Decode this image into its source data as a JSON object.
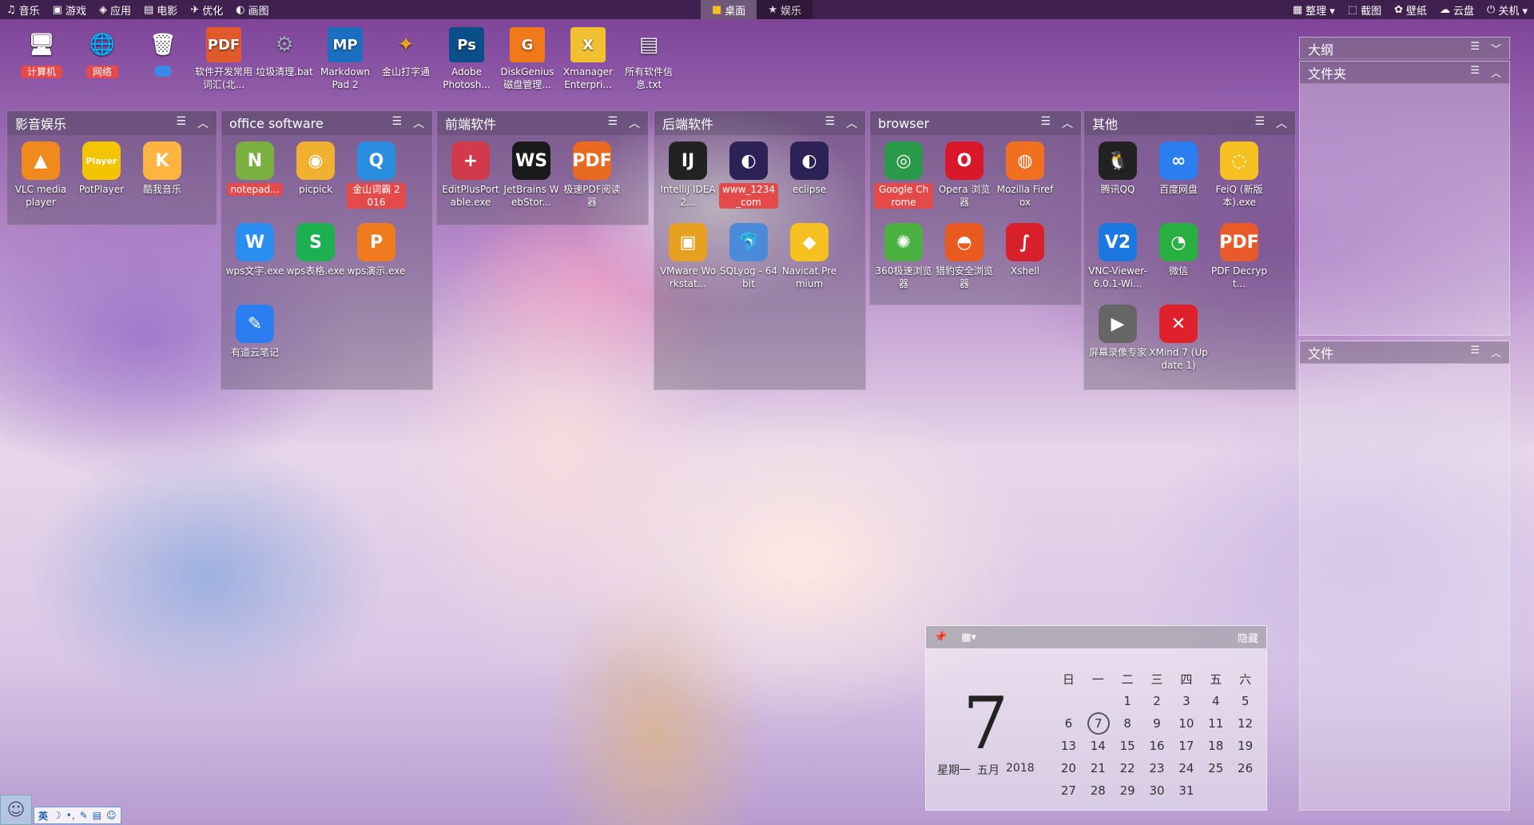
{
  "topbar": {
    "left": [
      {
        "icon": "music-note-icon",
        "glyph": "♫",
        "label": "音乐"
      },
      {
        "icon": "gamepad-icon",
        "glyph": "▣",
        "label": "游戏"
      },
      {
        "icon": "cube-icon",
        "glyph": "◈",
        "label": "应用"
      },
      {
        "icon": "film-icon",
        "glyph": "▤",
        "label": "电影"
      },
      {
        "icon": "rocket-icon",
        "glyph": "✈",
        "label": "优化"
      },
      {
        "icon": "palette-icon",
        "glyph": "◐",
        "label": "画图"
      }
    ],
    "tabs": [
      {
        "label": "桌面",
        "icon": "windows-logo-icon",
        "glyph": "■"
      },
      {
        "label": "娱乐",
        "icon": "star-icon",
        "glyph": "★"
      }
    ],
    "right": [
      {
        "icon": "organize-icon",
        "glyph": "▦",
        "label": "整理 ▾"
      },
      {
        "icon": "screenshot-icon",
        "glyph": "⬚",
        "label": "截图"
      },
      {
        "icon": "wallpaper-icon",
        "glyph": "✿",
        "label": "壁纸"
      },
      {
        "icon": "cloud-icon",
        "glyph": "☁",
        "label": "云盘"
      },
      {
        "icon": "power-icon",
        "glyph": "⏻",
        "label": "关机 ▾"
      }
    ]
  },
  "desktop_icons": [
    {
      "label": "计算机",
      "icon": "computer-icon",
      "glyph": "🖥",
      "tag": true
    },
    {
      "label": "网络",
      "icon": "network-globe-icon",
      "glyph": "🌐",
      "tag": true
    },
    {
      "label": "",
      "icon": "recycle-bin-icon",
      "glyph": "🗑",
      "tag_blue": true
    },
    {
      "label": "软件开发常用词汇(北...",
      "icon": "pdf-file-icon",
      "glyph": "PDF",
      "color": "#e05a2a"
    },
    {
      "label": "垃圾清理.bat",
      "icon": "bat-file-icon",
      "glyph": "⚙",
      "color": "#9aa8b8"
    },
    {
      "label": "Markdown Pad 2",
      "icon": "markdownpad-icon",
      "glyph": "MP",
      "color": "#1c6fc0"
    },
    {
      "label": "金山打字通",
      "icon": "jinshan-typing-icon",
      "glyph": "✦",
      "color": "#e8a020"
    },
    {
      "label": "Adobe Photosh...",
      "icon": "photoshop-icon",
      "glyph": "Ps",
      "color": "#0b4f8a"
    },
    {
      "label": "DiskGenius 磁盘管理...",
      "icon": "diskgenius-icon",
      "glyph": "G",
      "color": "#f07a1a"
    },
    {
      "label": "Xmanager Enterpri...",
      "icon": "xmanager-icon",
      "glyph": "X",
      "color": "#f0c030"
    },
    {
      "label": "所有软件信息.txt",
      "icon": "txt-file-icon",
      "glyph": "▤",
      "color": "#e8e8e8"
    }
  ],
  "fences": [
    {
      "title": "影音娱乐",
      "items": [
        {
          "label": "VLC media player",
          "icon": "vlc-icon",
          "glyph": "▲",
          "color": "#f08a1c"
        },
        {
          "label": "PotPlayer",
          "icon": "potplayer-icon",
          "glyph": "Player",
          "color": "#f5c400"
        },
        {
          "label": "酷我音乐",
          "icon": "kuwo-music-icon",
          "glyph": "K",
          "color": "#ffb340"
        }
      ]
    },
    {
      "title": "office software",
      "items": [
        {
          "label": "notepad...",
          "icon": "notepadpp-icon",
          "glyph": "N",
          "color": "#7ab040",
          "hl": true
        },
        {
          "label": "picpick",
          "icon": "picpick-icon",
          "glyph": "◉",
          "color": "#f0b030"
        },
        {
          "label": "金山词霸 2016",
          "icon": "jinshan-ciba-icon",
          "glyph": "Q",
          "color": "#2a8ee0",
          "hl": true
        },
        {
          "label": "wps文字.exe",
          "icon": "wps-writer-icon",
          "glyph": "W",
          "color": "#2a8ef0"
        },
        {
          "label": "wps表格.exe",
          "icon": "wps-sheet-icon",
          "glyph": "S",
          "color": "#1cb050"
        },
        {
          "label": "wps演示.exe",
          "icon": "wps-slides-icon",
          "glyph": "P",
          "color": "#f07a20"
        },
        {
          "label": "有道云笔记",
          "icon": "youdao-note-icon",
          "glyph": "✎",
          "color": "#2a7ef0"
        }
      ]
    },
    {
      "title": "前端软件",
      "items": [
        {
          "label": "EditPlusPortable.exe",
          "icon": "editplus-icon",
          "glyph": "+",
          "color": "#d03a4a"
        },
        {
          "label": "JetBrains WebStor...",
          "icon": "webstorm-icon",
          "glyph": "WS",
          "color": "#1a1a1a"
        },
        {
          "label": "极速PDF阅读器",
          "icon": "pdf-reader-icon",
          "glyph": "PDF",
          "color": "#e86a20"
        }
      ]
    },
    {
      "title": "后端软件",
      "items": [
        {
          "label": "IntelliJ IDEA 2...",
          "icon": "intellij-icon",
          "glyph": "IJ",
          "color": "#222"
        },
        {
          "label": "www_1234_com",
          "icon": "eclipse-variant-icon",
          "glyph": "◐",
          "color": "#2c2255",
          "hl": true
        },
        {
          "label": "eclipse",
          "icon": "eclipse-icon",
          "glyph": "◐",
          "color": "#2c2255"
        },
        {
          "label": "VMware Workstat...",
          "icon": "vmware-icon",
          "glyph": "▣",
          "color": "#e8a020"
        },
        {
          "label": "SQLyog - 64 bit",
          "icon": "sqlyog-icon",
          "glyph": "🐬",
          "color": "#4a8ad8"
        },
        {
          "label": "Navicat Premium",
          "icon": "navicat-icon",
          "glyph": "◆",
          "color": "#f5c020"
        }
      ]
    },
    {
      "title": "browser",
      "items": [
        {
          "label": "Google Chrome",
          "icon": "chrome-icon",
          "glyph": "◎",
          "color": "#2a9a4a",
          "hl": true
        },
        {
          "label": "Opera 浏览器",
          "icon": "opera-icon",
          "glyph": "O",
          "color": "#d8182a"
        },
        {
          "label": "Mozilla Firefox",
          "icon": "firefox-icon",
          "glyph": "◍",
          "color": "#f07020"
        },
        {
          "label": "360极速浏览器",
          "icon": "360-browser-icon",
          "glyph": "✺",
          "color": "#4ab040"
        },
        {
          "label": "猎豹安全浏览器",
          "icon": "liebao-browser-icon",
          "glyph": "◓",
          "color": "#e85a20"
        },
        {
          "label": "Xshell",
          "icon": "xshell-icon",
          "glyph": "∫",
          "color": "#d8202a"
        }
      ]
    },
    {
      "title": "其他",
      "items": [
        {
          "label": "腾讯QQ",
          "icon": "qq-penguin-icon",
          "glyph": "🐧",
          "color": "#222"
        },
        {
          "label": "百度网盘",
          "icon": "baidu-netdisk-icon",
          "glyph": "∞",
          "color": "#2a7ef0"
        },
        {
          "label": "FeiQ (新版本).exe",
          "icon": "feiq-icon",
          "glyph": "◌",
          "color": "#f5c020"
        },
        {
          "label": "VNC-Viewer-6.0.1-Wi...",
          "icon": "vnc-viewer-icon",
          "glyph": "V2",
          "color": "#1a78e0"
        },
        {
          "label": "微信",
          "icon": "wechat-icon",
          "glyph": "◔",
          "color": "#2ab040"
        },
        {
          "label": "PDF Decrypt...",
          "icon": "pdf-decrypt-icon",
          "glyph": "PDF",
          "color": "#e85a2a"
        },
        {
          "label": "屏幕录像专家",
          "icon": "screen-recorder-icon",
          "glyph": "▶",
          "color": "#666"
        },
        {
          "label": "XMind 7 (Update 1)",
          "icon": "xmind-icon",
          "glyph": "✕",
          "color": "#e0202a"
        }
      ]
    }
  ],
  "side_panels": [
    {
      "title": "大纲"
    },
    {
      "title": "文件夹"
    },
    {
      "title": "文件"
    }
  ],
  "fence_ctrls": {
    "menu": "☰",
    "collapse": "︿",
    "expand": "﹀"
  },
  "calendar": {
    "pin": "📌",
    "calendar_icon": "▦▾",
    "hide_label": "隐藏",
    "day": "7",
    "weekday": "星期一",
    "month": "五月",
    "year": "2018",
    "week_headers": [
      "日",
      "一",
      "二",
      "三",
      "四",
      "五",
      "六"
    ],
    "rows": [
      [
        "",
        "",
        "1",
        "2",
        "3",
        "4",
        "5"
      ],
      [
        "6",
        "7",
        "8",
        "9",
        "10",
        "11",
        "12"
      ],
      [
        "13",
        "14",
        "15",
        "16",
        "17",
        "18",
        "19"
      ],
      [
        "20",
        "21",
        "22",
        "23",
        "24",
        "25",
        "26"
      ],
      [
        "27",
        "28",
        "29",
        "30",
        "31",
        "",
        ""
      ]
    ],
    "today": "7"
  },
  "tray": {
    "ime_label": "英",
    "ime_icons": [
      "☽",
      "•,",
      "✎",
      "▤",
      "☺"
    ]
  }
}
